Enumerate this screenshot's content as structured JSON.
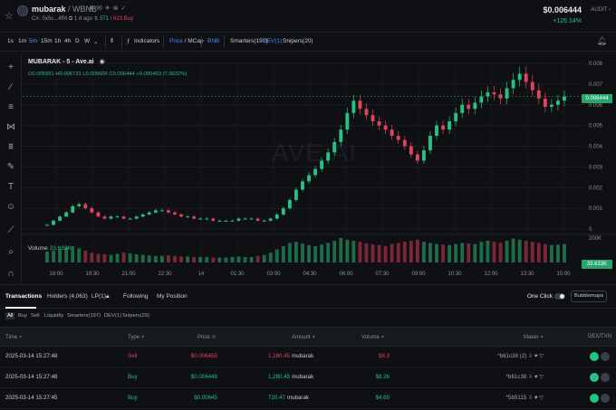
{
  "header": {
    "pair_base": "mubarak",
    "pair_quote": "/ WBNB",
    "contract": "CA: 0x5c...4ff4",
    "age": "1 d ago",
    "buys_green": "571",
    "buys_red": "623 Buy",
    "price": "$0.006444",
    "change": "+126.14%",
    "audit": "AUDIT"
  },
  "toolbar": {
    "timeframes": [
      "1s",
      "1m",
      "5m",
      "15m",
      "1h",
      "4h",
      "D",
      "W"
    ],
    "active_timeframe": "5m",
    "indicators": "Indicators",
    "price_mcap": "Price / MCap",
    "price_label": "Price",
    "mcap_label": "MCap",
    "bnb": "BNB",
    "smarters": "Smarters(197)",
    "dev": "DEV(1)",
    "snipers": "Snipers(20)"
  },
  "chart": {
    "legend_title": "MUBARAK - 5 - Ave.ai",
    "ohlc": {
      "o_label": "O",
      "o": "0.005991",
      "h_label": "H",
      "h": "0.006731",
      "l_label": "L",
      "l": "0.005666",
      "c_label": "C",
      "c": "0.006444",
      "chg": "+0.000453 (7.5632%)"
    },
    "watermark": "AVE.AI",
    "volume_label": "Volume",
    "volume_value": "33.633K",
    "current_price_tag": "0.006444",
    "volume_tag": "33.633K"
  },
  "chart_data": {
    "type": "candlestick",
    "title": "MUBARAK - 5 - Ave.ai",
    "x_ticks": [
      "18:00",
      "19:30",
      "21:00",
      "22:30",
      "14",
      "01:30",
      "03:00",
      "04:30",
      "06:00",
      "07:30",
      "09:00",
      "10:30",
      "12:00",
      "13:30",
      "15:00"
    ],
    "y_ticks": [
      "0.008",
      "0.007",
      "0.006",
      "0.005",
      "0.004",
      "0.003",
      "0.002",
      "0.001",
      "0"
    ],
    "volume_ticks": [
      "200K"
    ],
    "ylim": [
      0,
      0.008
    ],
    "series": [
      {
        "name": "price",
        "values": [
          0.0002,
          0.0004,
          0.0006,
          0.0008,
          0.0011,
          0.0012,
          0.001,
          0.0008,
          0.0006,
          0.0005,
          0.0006,
          0.0006,
          0.0005,
          0.0005,
          0.0006,
          0.0007,
          0.0008,
          0.0009,
          0.0009,
          0.0008,
          0.0007,
          0.0006,
          0.0006,
          0.0005,
          0.0005,
          0.0005,
          0.0004,
          0.0004,
          0.0004,
          0.0004,
          0.0005,
          0.0005,
          0.0005,
          0.0004,
          0.0004,
          0.0005,
          0.0007,
          0.001,
          0.0014,
          0.0019,
          0.0023,
          0.0026,
          0.0029,
          0.0033,
          0.0037,
          0.0042,
          0.0048,
          0.0056,
          0.0062,
          0.0058,
          0.0055,
          0.0052,
          0.005,
          0.0048,
          0.0045,
          0.0043,
          0.004,
          0.0036,
          0.0033,
          0.0038,
          0.0045,
          0.005,
          0.0048,
          0.0052,
          0.0056,
          0.006,
          0.0058,
          0.0061,
          0.0064,
          0.0066,
          0.0065,
          0.0063,
          0.0068,
          0.0072,
          0.0075,
          0.0071,
          0.0067,
          0.0063,
          0.0059,
          0.006,
          0.0062,
          0.0064
        ]
      }
    ],
    "volume": [
      20,
      22,
      24,
      28,
      30,
      26,
      22,
      18,
      16,
      15,
      14,
      16,
      18,
      17,
      15,
      14,
      13,
      12,
      12,
      13,
      12,
      11,
      11,
      10,
      10,
      10,
      9,
      9,
      9,
      10,
      11,
      10,
      10,
      12,
      14,
      18,
      24,
      30,
      36,
      38,
      35,
      32,
      30,
      33,
      36,
      40,
      45,
      42,
      40,
      38,
      35,
      33,
      32,
      30,
      34,
      36,
      38,
      40,
      42,
      38,
      36,
      34,
      33,
      32,
      34,
      36,
      35,
      34,
      38,
      40,
      38,
      36,
      40,
      44,
      42,
      40,
      38,
      36,
      34,
      32,
      33,
      34
    ],
    "grid": true
  },
  "panel": {
    "tabs": [
      "Transactions",
      "Holders (4,063)",
      "LP(1)",
      "Following",
      "My Position"
    ],
    "one_click": "One Click",
    "bubblemaps": "Bubblemaps",
    "filters": [
      "All",
      "Buy",
      "Sell",
      "Liquidity",
      "Smarters(197)",
      "DEV(1)",
      "Snipers(20)"
    ]
  },
  "table": {
    "columns": [
      "Time",
      "Type",
      "Price",
      "Amount",
      "Volume",
      "Maker",
      "DEX/TXN"
    ],
    "rows": [
      {
        "time": "2025-03-14 15:27:48",
        "type": "Sell",
        "price": "$0.006455",
        "amount_num": "1,280.45",
        "amount_token": "mubarak",
        "volume": "$8.3",
        "maker": "*b61c38 (2)"
      },
      {
        "time": "2025-03-14 15:27:48",
        "type": "Buy",
        "price": "$0.006449",
        "amount_num": "1,280.45",
        "amount_token": "mubarak",
        "volume": "$8.26",
        "maker": "*b61c38"
      },
      {
        "time": "2025-03-14 15:27:45",
        "type": "Buy",
        "price": "$0.00645",
        "amount_num": "720.47",
        "amount_token": "mubarak",
        "volume": "$4.65",
        "maker": "*5b5115"
      }
    ]
  },
  "colors": {
    "up": "#26c281",
    "down": "#e2435d",
    "accent": "#4f87ff",
    "background": "#0e1014"
  }
}
